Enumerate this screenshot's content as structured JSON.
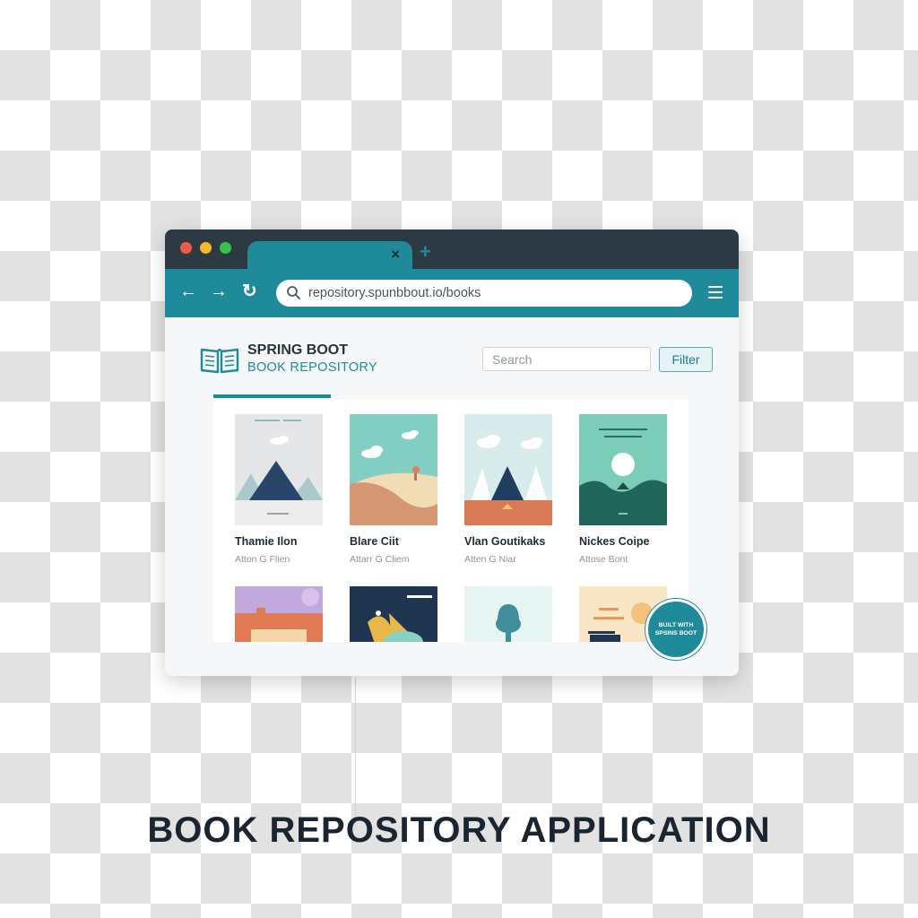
{
  "browser": {
    "url": "repository.spunbbout.io/books",
    "tab_close_glyph": "×",
    "tab_add_glyph": "+",
    "back_glyph": "←",
    "forward_glyph": "→",
    "reload_glyph": "↻"
  },
  "app": {
    "title_line1": "SPRING BOOT",
    "title_line2": "BOOK REPOSITORY",
    "search_placeholder": "Search",
    "filter_label": "Filter",
    "logo_icon": "open-book-icon"
  },
  "books": [
    {
      "title": "Thamie Ilon",
      "author": "Atton G Flien"
    },
    {
      "title": "Blare Ciit",
      "author": "Attarr G Cliem"
    },
    {
      "title": "Vlan Goutikaks",
      "author": "Atten G Niar"
    },
    {
      "title": "Nickes Coipe",
      "author": "Attose Bont"
    }
  ],
  "badge": {
    "line1": "BUILT WITH",
    "line2": "SPSINS BOOT"
  },
  "caption": "BOOK REPOSITORY APPLICATION",
  "colors": {
    "accent": "#1f8a9a",
    "titlebar": "#2d3a44",
    "text_dark": "#1b2530"
  }
}
